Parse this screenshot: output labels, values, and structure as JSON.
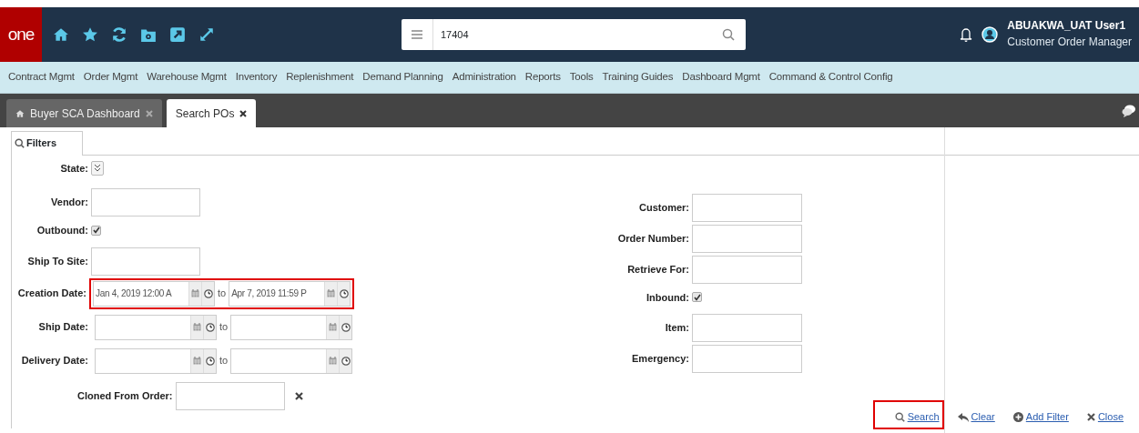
{
  "header": {
    "logo": "one",
    "search": {
      "value": "17404"
    },
    "user": {
      "name": "ABUAKWA_UAT User1",
      "role": "Customer Order Manager"
    }
  },
  "menu": [
    "Contract Mgmt",
    "Order Mgmt",
    "Warehouse Mgmt",
    "Inventory",
    "Replenishment",
    "Demand Planning",
    "Administration",
    "Reports",
    "Tools",
    "Training Guides",
    "Dashboard Mgmt",
    "Command & Control Config"
  ],
  "tabs": [
    {
      "label": "Buyer SCA Dashboard",
      "selected": false,
      "kind": "home"
    },
    {
      "label": "Search POs",
      "selected": true,
      "kind": "plain"
    }
  ],
  "panel_tab": {
    "label": "Filters"
  },
  "left_filters": [
    {
      "kind": "dropdown",
      "label": "State:"
    },
    {
      "kind": "text",
      "label": "Vendor:"
    },
    {
      "kind": "checkbox",
      "label": "Outbound:",
      "checked": true
    },
    {
      "kind": "text",
      "label": "Ship To Site:"
    },
    {
      "kind": "daterange",
      "label": "Creation Date:",
      "from": "Jan 4, 2019 12:00 A",
      "to_label": "to",
      "to": "Apr 7, 2019 11:59 P",
      "highlighted": true
    },
    {
      "kind": "daterange",
      "label": "Ship Date:",
      "to_label": "to",
      "highlighted": false
    },
    {
      "kind": "daterange",
      "label": "Delivery Date:",
      "to_label": "to",
      "highlighted": false
    },
    {
      "kind": "clearable",
      "label": "Cloned From Order:"
    }
  ],
  "right_filters": [
    {
      "kind": "text",
      "label": "Customer:"
    },
    {
      "kind": "text",
      "label": "Order Number:"
    },
    {
      "kind": "text",
      "label": "Retrieve For:"
    },
    {
      "kind": "checkbox",
      "label": "Inbound:",
      "checked": true
    },
    {
      "kind": "text",
      "label": "Item:"
    },
    {
      "kind": "text",
      "label": "Emergency:"
    }
  ],
  "actions": [
    {
      "kind": "search",
      "label": "Search",
      "highlighted": true
    },
    {
      "kind": "clear",
      "label": "Clear",
      "highlighted": false
    },
    {
      "kind": "add",
      "label": "Add Filter",
      "highlighted": false
    },
    {
      "kind": "close",
      "label": "Close",
      "highlighted": false
    }
  ]
}
